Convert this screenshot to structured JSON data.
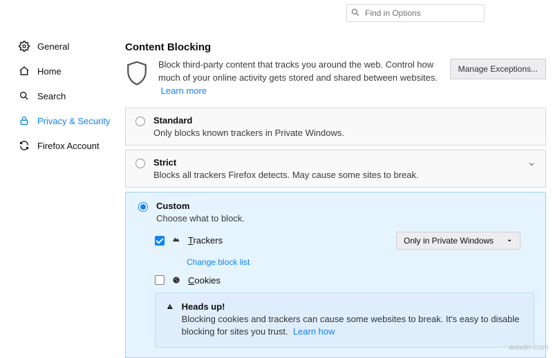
{
  "search": {
    "placeholder": "Find in Options"
  },
  "sidebar": {
    "items": [
      {
        "label": "General"
      },
      {
        "label": "Home"
      },
      {
        "label": "Search"
      },
      {
        "label": "Privacy & Security"
      },
      {
        "label": "Firefox Account"
      }
    ]
  },
  "content": {
    "title": "Content Blocking",
    "intro": "Block third-party content that tracks you around the web. Control how much of your online activity gets stored and shared between websites.",
    "learn_more": "Learn more",
    "manage_exceptions": "Manage Exceptions...",
    "options": {
      "standard": {
        "label": "Standard",
        "desc": "Only blocks known trackers in Private Windows."
      },
      "strict": {
        "label": "Strict",
        "desc": "Blocks all trackers Firefox detects. May cause some sites to break."
      },
      "custom": {
        "label": "Custom",
        "desc": "Choose what to block."
      }
    },
    "custom": {
      "trackers_label_pre": "T",
      "trackers_label_rest": "rackers",
      "trackers_checked": true,
      "trackers_scope": "Only in Private Windows",
      "change_block_list": "Change block list",
      "cookies_label_pre": "C",
      "cookies_label_rest": "ookies",
      "cookies_checked": false
    },
    "warning": {
      "title": "Heads up!",
      "text": "Blocking cookies and trackers can cause some websites to break. It's easy to disable blocking for sites you trust.",
      "learn_how": "Learn how"
    }
  },
  "watermark": "wsxdn.com"
}
